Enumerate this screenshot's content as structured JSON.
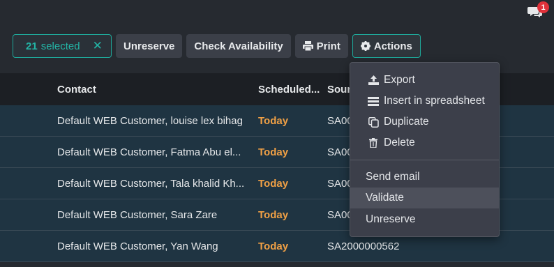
{
  "notifications": {
    "count": "1",
    "icon": "chat-icon"
  },
  "toolbar": {
    "selected_count": "21",
    "selected_label": "selected",
    "clear_icon": "✕",
    "unreserve": "Unreserve",
    "check_availability": "Check Availability",
    "print": "Print",
    "actions": "Actions"
  },
  "table": {
    "headers": {
      "contact": "Contact",
      "scheduled": "Scheduled...",
      "source": "Sour"
    },
    "rows": [
      {
        "contact": "Default WEB Customer, louise lex bihag",
        "scheduled": "Today",
        "source": "SA00"
      },
      {
        "contact": "Default WEB Customer, Fatma Abu el...",
        "scheduled": "Today",
        "source": "SA00"
      },
      {
        "contact": "Default WEB Customer, Tala khalid Kh...",
        "scheduled": "Today",
        "source": "SA00"
      },
      {
        "contact": "Default WEB Customer, Sara Zare",
        "scheduled": "Today",
        "source": "SA00"
      },
      {
        "contact": "Default WEB Customer, Yan Wang",
        "scheduled": "Today",
        "source": "SA2000000562"
      }
    ]
  },
  "actions_menu": {
    "export": "Export",
    "insert_spreadsheet": "Insert in spreadsheet",
    "duplicate": "Duplicate",
    "delete": "Delete",
    "send_email": "Send email",
    "validate": "Validate",
    "unreserve": "Unreserve"
  },
  "colors": {
    "accent": "#1fa89a",
    "today": "#f0a045",
    "row_bg": "#1f3442",
    "badge": "#e0313a"
  }
}
